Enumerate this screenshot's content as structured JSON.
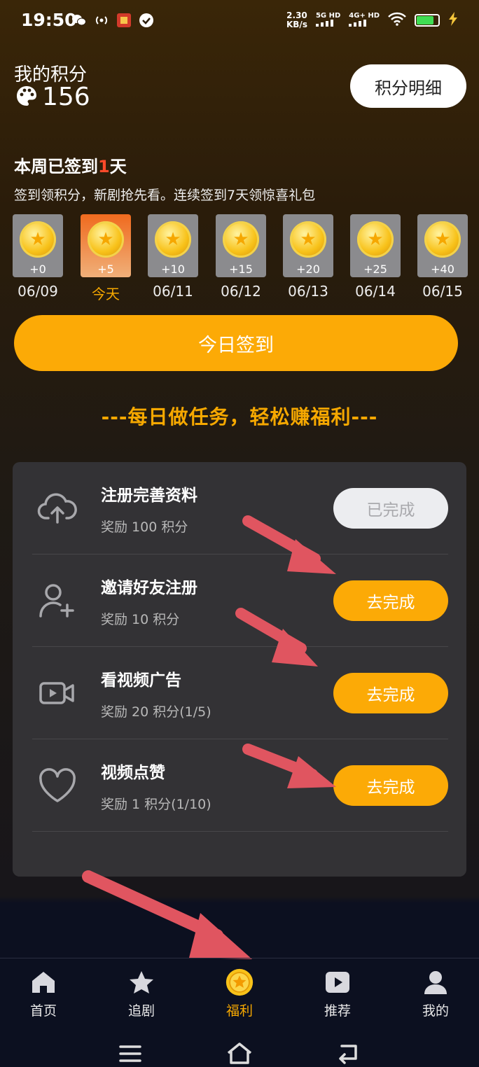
{
  "status_bar": {
    "time": "19:50",
    "net_speed_value": "2.30",
    "net_speed_unit": "KB/s",
    "sim1": "5G HD",
    "sim2": "4G+ HD"
  },
  "points": {
    "label": "我的积分",
    "value": "156",
    "detail_button": "积分明细"
  },
  "checkin": {
    "title_prefix": "本周已签到",
    "title_count": "1",
    "title_suffix": "天",
    "subtitle": "签到领积分，新剧抢先看。连续签到7天领惊喜礼包",
    "days": [
      {
        "reward": "+0",
        "date": "06/09"
      },
      {
        "reward": "+5",
        "date": "今天"
      },
      {
        "reward": "+10",
        "date": "06/11"
      },
      {
        "reward": "+15",
        "date": "06/12"
      },
      {
        "reward": "+20",
        "date": "06/13"
      },
      {
        "reward": "+25",
        "date": "06/14"
      },
      {
        "reward": "+40",
        "date": "06/15"
      }
    ],
    "sign_button": "今日签到"
  },
  "tasks_heading": "---每日做任务，轻松赚福利---",
  "tasks": [
    {
      "name": "注册完善资料",
      "reward": "奖励 100 积分",
      "button": "已完成",
      "icon": "cloud-upload-icon"
    },
    {
      "name": "邀请好友注册",
      "reward": "奖励 10 积分",
      "button": "去完成",
      "icon": "add-user-icon"
    },
    {
      "name": "看视频广告",
      "reward": "奖励 20 积分(1/5)",
      "button": "去完成",
      "icon": "video-camera-icon"
    },
    {
      "name": "视频点赞",
      "reward": "奖励 1 积分(1/10)",
      "button": "去完成",
      "icon": "heart-icon"
    }
  ],
  "nav": [
    {
      "label": "首页",
      "icon": "home-icon"
    },
    {
      "label": "追剧",
      "icon": "star-icon"
    },
    {
      "label": "福利",
      "icon": "coin-icon"
    },
    {
      "label": "推荐",
      "icon": "play-icon"
    },
    {
      "label": "我的",
      "icon": "profile-icon"
    }
  ],
  "colors": {
    "accent": "#fcaa06",
    "today_card": "#f06a1e",
    "highlight": "#ff4a2a",
    "arrow": "#e05560"
  }
}
